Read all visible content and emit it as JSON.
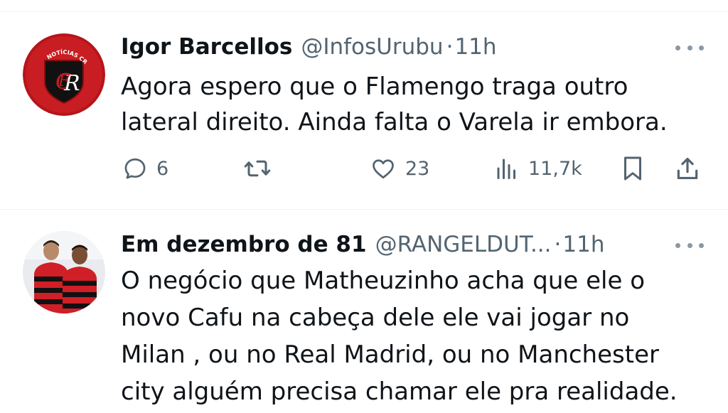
{
  "tweets": [
    {
      "author_name": "Igor Barcellos",
      "handle": "@InfosUrubu",
      "separator": "·",
      "time": "11h",
      "text": "Agora espero que o Flamengo traga outro\nlateral direito. Ainda falta o Varela ir embora.",
      "avatar_icon": "flamengo-crf-logo-icon",
      "avatar_logo_text": "NOTÍCIAS CRF",
      "actions": {
        "replies": "6",
        "retweets": "",
        "likes": "23",
        "views": "11,7k"
      }
    },
    {
      "author_name": "Em dezembro de 81",
      "handle": "@RANGELDUT...",
      "separator": "·",
      "time": "11h",
      "text": "O negócio que Matheuzinho acha que ele o\nnovo Cafu na cabeça dele ele vai jogar no\nMilan , ou no Real Madrid, ou no Manchester\ncity alguém precisa chamar ele  pra realidade.",
      "avatar_icon": "two-players-photo-icon"
    }
  ],
  "colors": {
    "text": "#0f1419",
    "muted": "#536471",
    "divider": "#eff3f4",
    "flamengo_red": "#c4161c"
  }
}
